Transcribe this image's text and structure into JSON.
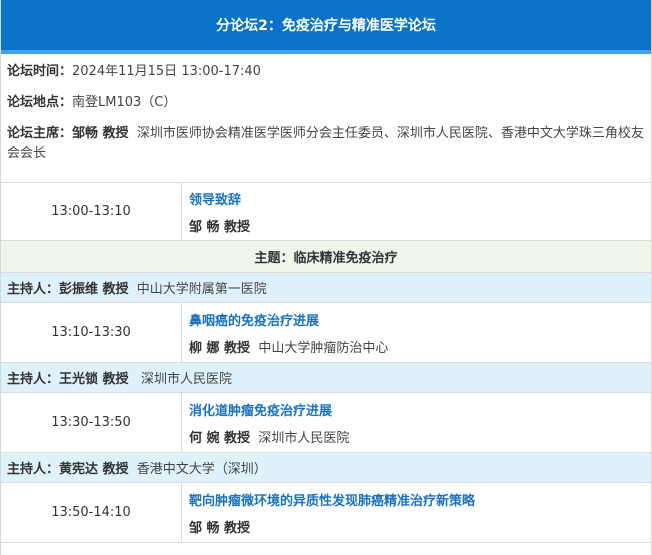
{
  "header": {
    "title": "分论坛2：免疫治疗与精准医学论坛"
  },
  "info": {
    "time_label": "论坛时间：",
    "time_value": "2024年11月15日 13:00-17:40",
    "place_label": "论坛地点：",
    "place_value": "南登LM103（C）",
    "chair_label": "论坛主席：",
    "chair_name": "邹畅 教授",
    "chair_desc": "深圳市医师协会精准医学医师分会主任委员、深圳市人民医院、香港中文大学珠三角校友会会长"
  },
  "rows": {
    "talk1": {
      "time": "13:00-13:10",
      "title": "领导致辞",
      "speaker": "邹 畅 教授",
      "affil": ""
    },
    "theme": "主题：临床精准免疫治疗",
    "host1": {
      "label": "主持人：彭振维 教授",
      "affil": "中山大学附属第一医院"
    },
    "talk2": {
      "time": "13:10-13:30",
      "title": "鼻咽癌的免疫治疗进展",
      "speaker": "柳 娜 教授",
      "affil": "中山大学肿瘤防治中心"
    },
    "host2": {
      "label": "主持人：王光锁 教授",
      "affil": "深圳市人民医院"
    },
    "talk3": {
      "time": "13:30-13:50",
      "title": "消化道肿瘤免疫治疗进展",
      "speaker": "何 婉 教授",
      "affil": "深圳市人民医院"
    },
    "host3": {
      "label": "主持人：黄宪达 教授",
      "affil": "香港中文大学（深圳）"
    },
    "talk4": {
      "time": "13:50-14:10",
      "title": "靶向肿瘤微环境的异质性发现肺癌精准治疗新策略",
      "speaker": "邹 畅 教授",
      "affil": ""
    }
  },
  "colors": {
    "header_bg": "#0a73c9",
    "title_link": "#1a73c0",
    "host_bg": "#dff1fb",
    "theme_bg": "#eef7ea"
  }
}
